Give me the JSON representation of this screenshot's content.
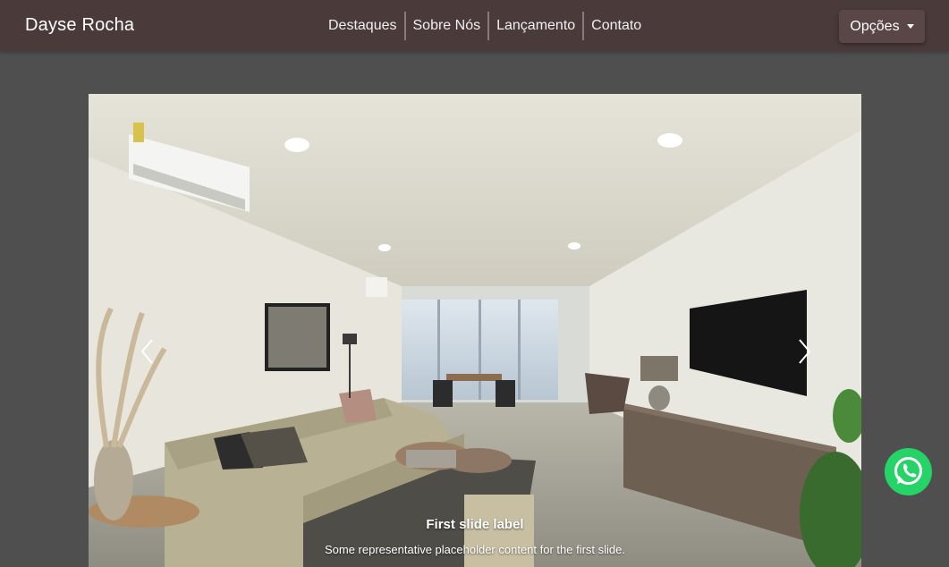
{
  "navbar": {
    "brand": "Dayse Rocha",
    "links": [
      "Destaques",
      "Sobre Nós",
      "Lançamento",
      "Contato"
    ],
    "dropdown_label": "Opções"
  },
  "carousel": {
    "caption_title": "First slide label",
    "caption_text": "Some representative placeholder content for the first slide."
  },
  "icons": {
    "prev": "chevron-left-icon",
    "next": "chevron-right-icon",
    "whatsapp": "whatsapp-icon"
  },
  "colors": {
    "navbar": "#4a3a3a",
    "page_background": "#4f4f4f",
    "whatsapp": "#25d366"
  }
}
